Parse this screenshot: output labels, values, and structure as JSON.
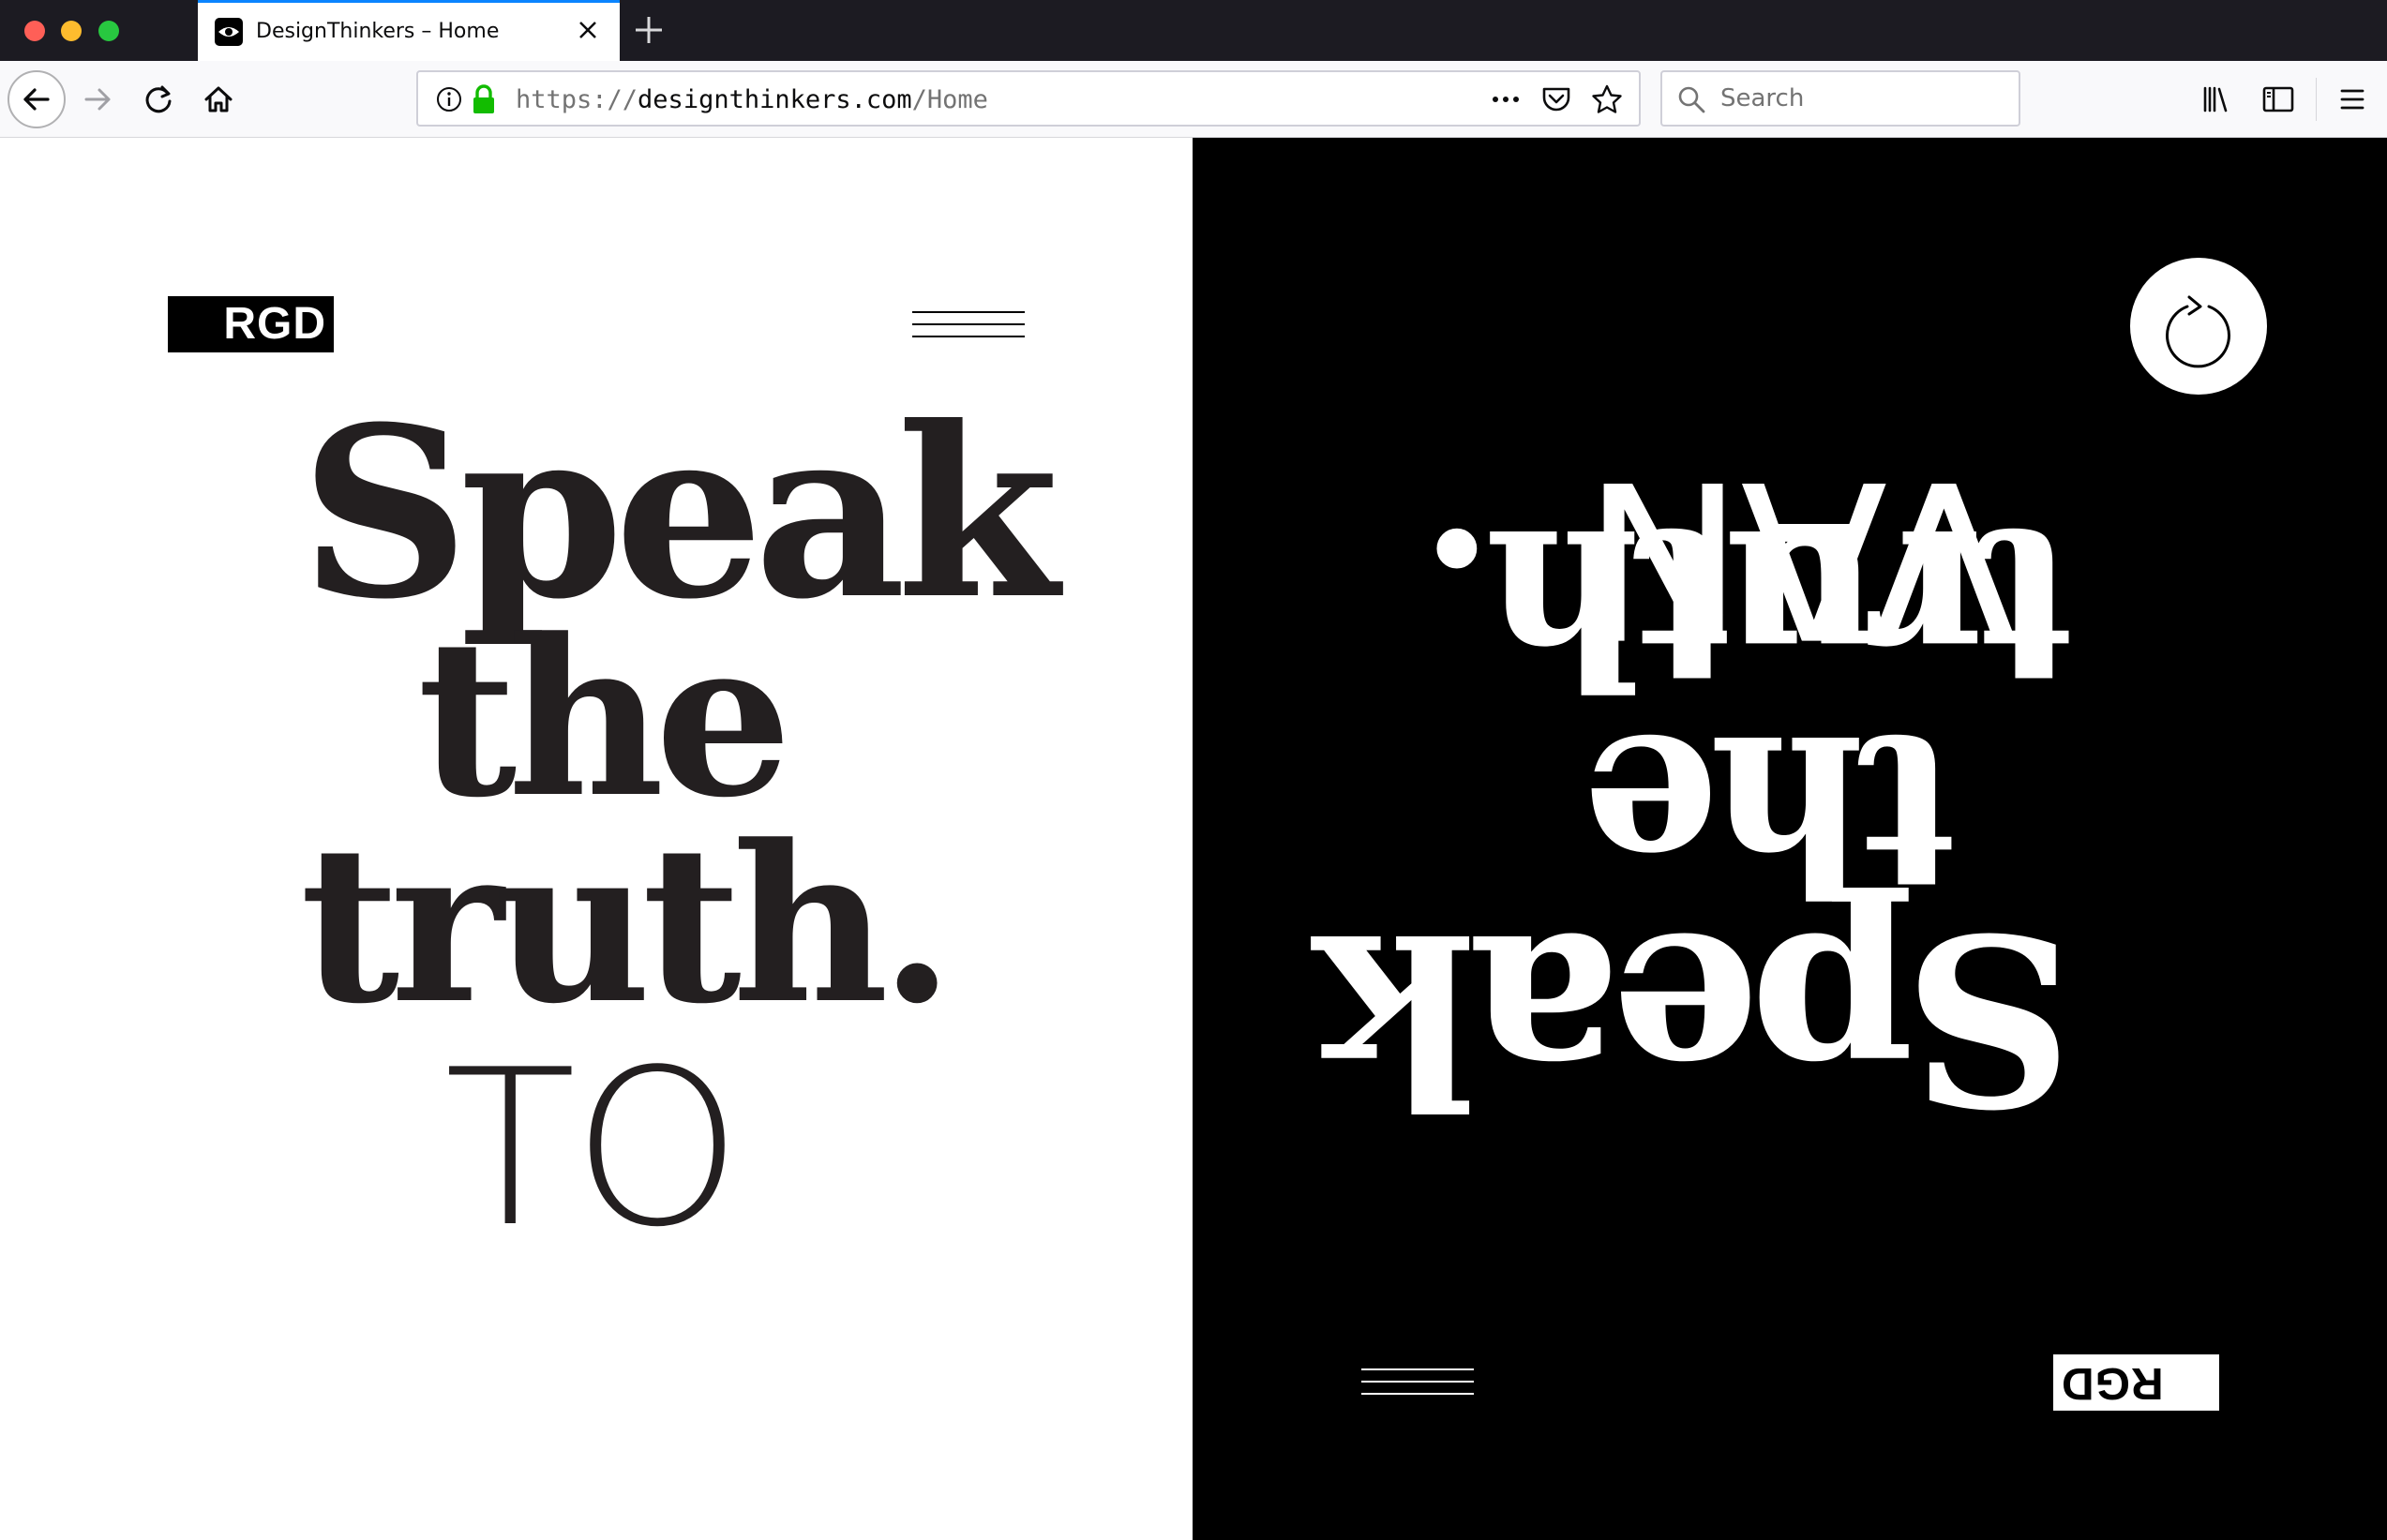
{
  "browser": {
    "tab_title": "DesignThinkers – Home",
    "url": {
      "scheme": "https://",
      "domain": "designthinkers.com",
      "path": "/Home"
    },
    "search_placeholder": "Search"
  },
  "page": {
    "logo_text": "RGD",
    "headline": [
      "Speak",
      "the",
      "truth."
    ],
    "left_subword": "TO",
    "right_subword": "VAN",
    "colors": {
      "left_bg": "#ffffff",
      "right_bg": "#000000",
      "text_dark": "#231f20",
      "text_light": "#ffffff"
    }
  }
}
